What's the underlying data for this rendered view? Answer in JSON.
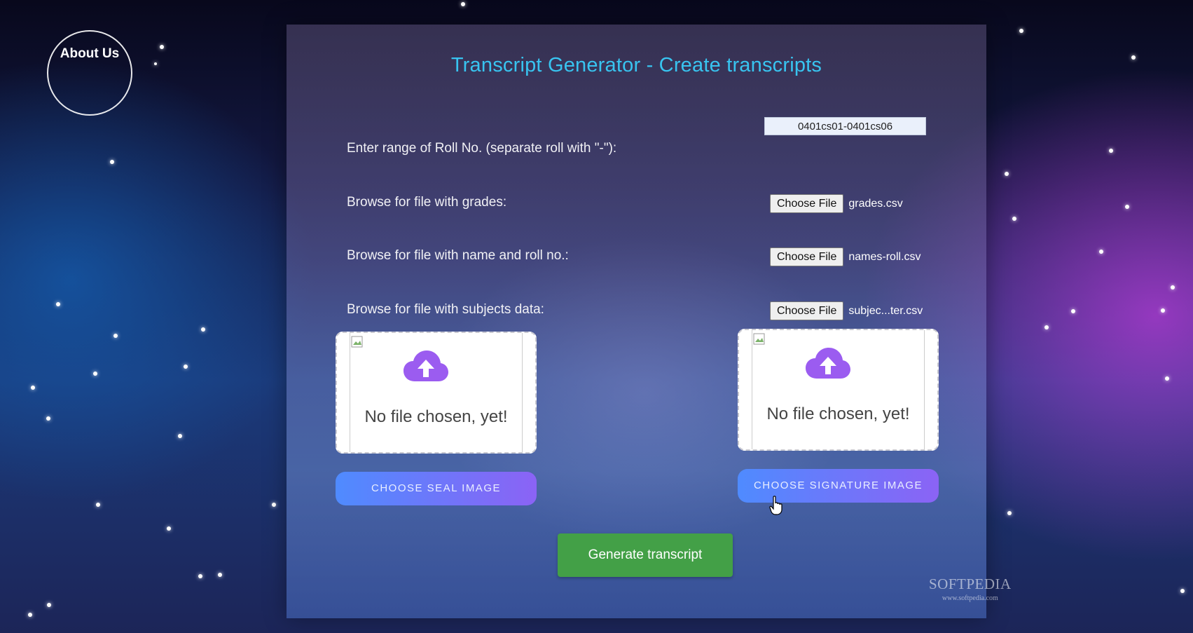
{
  "about_button": {
    "label": "About Us"
  },
  "form": {
    "title": "Transcript Generator - Create transcripts",
    "roll_range": {
      "label": "Enter range of Roll No. (separate roll with \"-\"):",
      "value": "0401cs01-0401cs06"
    },
    "grades_file": {
      "label": "Browse for file with grades:",
      "button": "Choose File",
      "file_name": "grades.csv"
    },
    "names_file": {
      "label": "Browse for file with name and roll no.:",
      "button": "Choose File",
      "file_name": "names-roll.csv"
    },
    "subjects_file": {
      "label": "Browse for file with subjects data:",
      "button": "Choose File",
      "file_name": "subjec...ter.csv"
    },
    "seal_upload": {
      "placeholder": "No file chosen, yet!",
      "button": "CHOOSE SEAL IMAGE",
      "icon": "cloud-upload-icon"
    },
    "signature_upload": {
      "placeholder": "No file chosen, yet!",
      "button": "CHOOSE SIGNATURE IMAGE",
      "icon": "cloud-upload-icon"
    },
    "generate_button": "Generate transcript"
  },
  "colors": {
    "title": "#38c4f0",
    "generate": "#43a047",
    "upload_start": "#4f8bff",
    "upload_end": "#8b63f5",
    "cloud": "#9b5cf0"
  },
  "watermark": {
    "brand": "SOFTPEDIA",
    "url": "www.softpedia.com"
  }
}
